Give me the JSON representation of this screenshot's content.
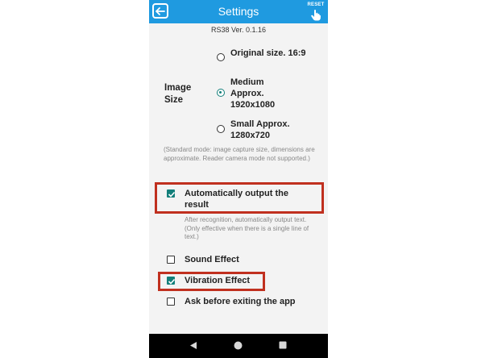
{
  "header": {
    "title": "Settings",
    "reset_label": "RESET",
    "background": "#1f9ae0"
  },
  "version": "RS38 Ver. 0.1.16",
  "image_size": {
    "label": "Image Size",
    "options": [
      {
        "label": "Original size. 16:9",
        "checked": false
      },
      {
        "label": "Medium Approx. 1920x1080",
        "checked": true
      },
      {
        "label": "Small Approx. 1280x720",
        "checked": false
      }
    ],
    "note": "(Standard mode: image capture size, dimensions are approximate. Reader camera mode not supported.)"
  },
  "options": [
    {
      "label": "Automatically output the result",
      "checked": true,
      "note": "After recognition, automatically output text. (Only effective when there is a single line of text.)"
    },
    {
      "label": "Sound Effect",
      "checked": false
    },
    {
      "label": "Vibration Effect",
      "checked": true
    },
    {
      "label": "Ask before exiting the app",
      "checked": false
    }
  ],
  "colors": {
    "accent": "#137f7a",
    "highlight": "#c0301f"
  },
  "nav_icons": [
    "back-triangle-icon",
    "home-circle-icon",
    "recents-square-icon"
  ]
}
